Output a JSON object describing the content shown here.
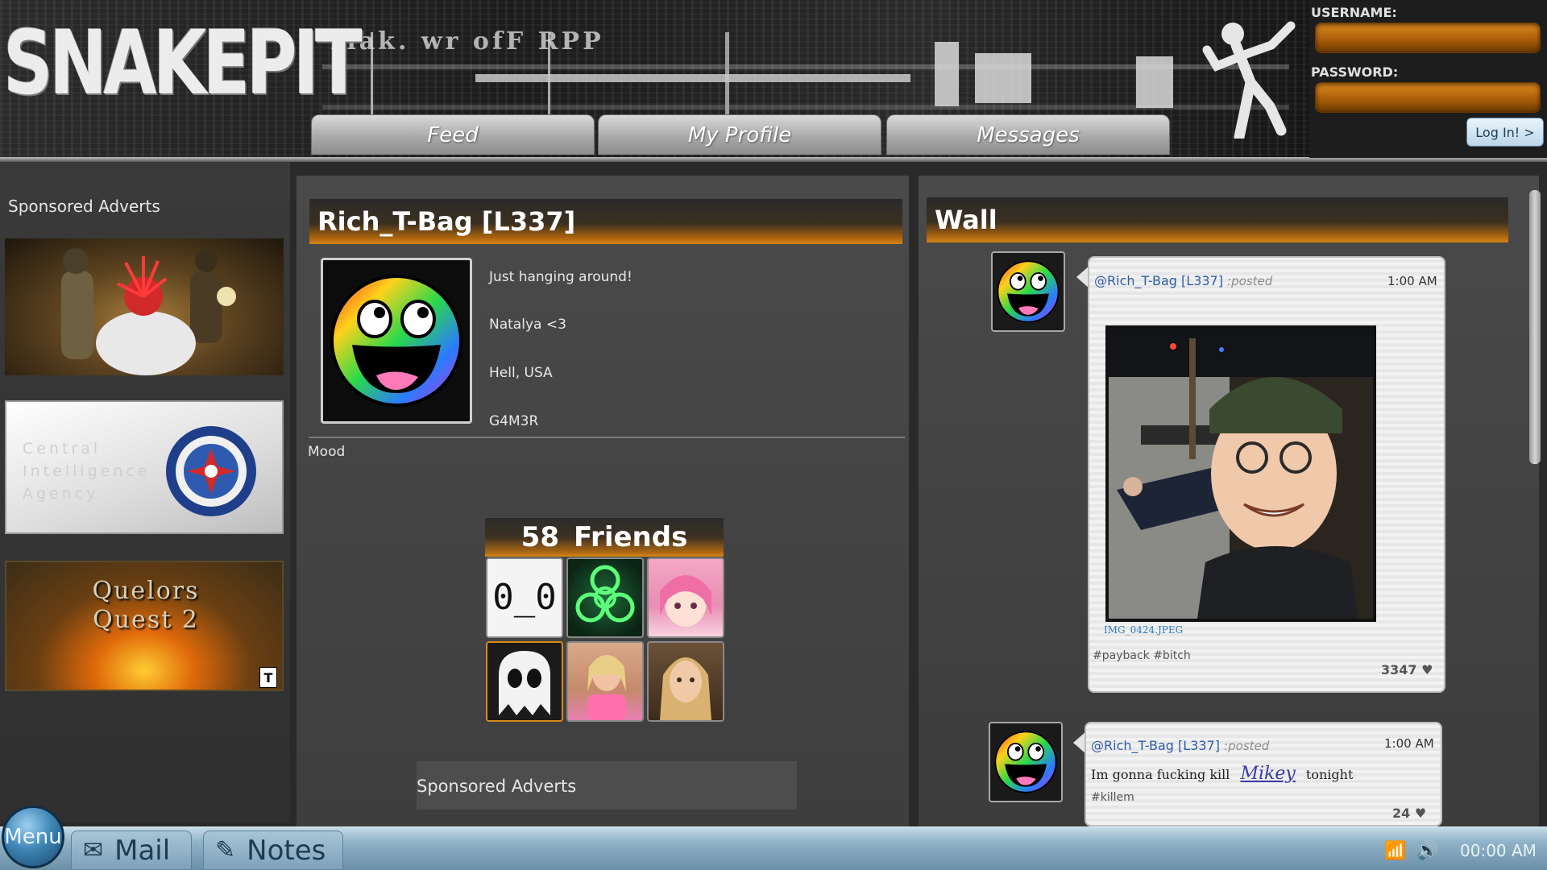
{
  "app": {
    "logo": "SNAKEPIT",
    "header_brush_text": "mak. wr ofF RPP"
  },
  "nav": {
    "tabs": [
      {
        "label": "Feed"
      },
      {
        "label": "My Profile"
      },
      {
        "label": "Messages"
      }
    ]
  },
  "login": {
    "username_label": "USERNAME:",
    "password_label": "PASSWORD:",
    "username_value": "",
    "password_value": "",
    "button_label": "Log In! >"
  },
  "sidebar": {
    "title": "Sponsored Adverts",
    "ads": [
      {
        "name": "war-ad"
      },
      {
        "name": "cia-ad",
        "text": "Central Intelligence Agency",
        "lines": [
          "Central",
          "Intelligence",
          "Agency"
        ]
      },
      {
        "name": "quest-ad",
        "text": "Quelors Quest 2",
        "lines": [
          "Quelors",
          "Quest 2"
        ],
        "rating": "T"
      }
    ]
  },
  "profile": {
    "name": "Rich_T-Bag [L337]",
    "status": "Just hanging around!",
    "relationship": "Natalya <3",
    "location": "Hell, USA",
    "tag": "G4M3R",
    "mood_label": "Mood",
    "friends_count": "58",
    "friends_label": "Friends",
    "friend_tile_text": "0_0",
    "sponsored_label": "Sponsored Adverts"
  },
  "wall": {
    "title": "Wall",
    "posts": [
      {
        "user": "@Rich_T-Bag [L337]",
        "verb": ":posted",
        "time": "1:00 AM",
        "image_name": "IMG_0424.JPEG",
        "tags": "#payback #bitch",
        "likes": "3347"
      },
      {
        "user": "@Rich_T-Bag [L337]",
        "verb": ":posted",
        "time": "1:00 AM",
        "text_before": "Im gonna fucking kill",
        "mention": "Mikey",
        "text_after": "tonight",
        "tags": "#killem",
        "likes": "24"
      }
    ]
  },
  "taskbar": {
    "menu_label": "Menu",
    "mail_label": "Mail",
    "notes_label": "Notes",
    "clock": "00:00 AM"
  },
  "colors": {
    "accent_orange": "#d58416",
    "link_blue": "#2e5ea8",
    "taskbar_blue": "#8fb2c7"
  }
}
